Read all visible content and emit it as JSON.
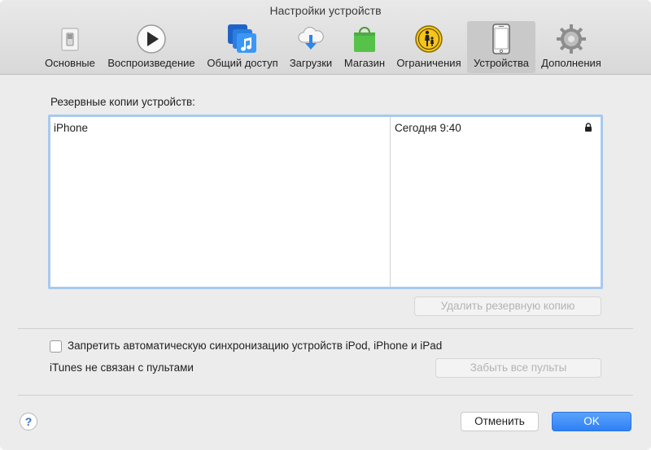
{
  "window": {
    "title": "Настройки устройств"
  },
  "toolbar": {
    "items": [
      {
        "label": "Основные",
        "icon": "switch-icon"
      },
      {
        "label": "Воспроизведение",
        "icon": "play-icon"
      },
      {
        "label": "Общий доступ",
        "icon": "music-share-icon"
      },
      {
        "label": "Загрузки",
        "icon": "cloud-download-icon"
      },
      {
        "label": "Магазин",
        "icon": "bag-icon"
      },
      {
        "label": "Ограничения",
        "icon": "parental-icon"
      },
      {
        "label": "Устройства",
        "icon": "iphone-icon",
        "selected": true
      },
      {
        "label": "Дополнения",
        "icon": "gear-icon"
      }
    ]
  },
  "backups": {
    "section_label": "Резервные копии устройств:",
    "rows": [
      {
        "name": "iPhone",
        "date": "Сегодня 9:40",
        "locked": true
      }
    ],
    "delete_button": "Удалить резервную копию"
  },
  "sync": {
    "checkbox_label": "Запретить автоматическую синхронизацию устройств iPod, iPhone и iPad",
    "checked": false,
    "remotes_label": "iTunes не связан с пультами",
    "forget_button": "Забыть все пульты"
  },
  "footer": {
    "help": "?",
    "cancel": "Отменить",
    "ok": "OK"
  },
  "colors": {
    "accent": "#2f80f5",
    "table_focus": "#a8c9ef",
    "selected_tab": "#c9c9c9"
  }
}
